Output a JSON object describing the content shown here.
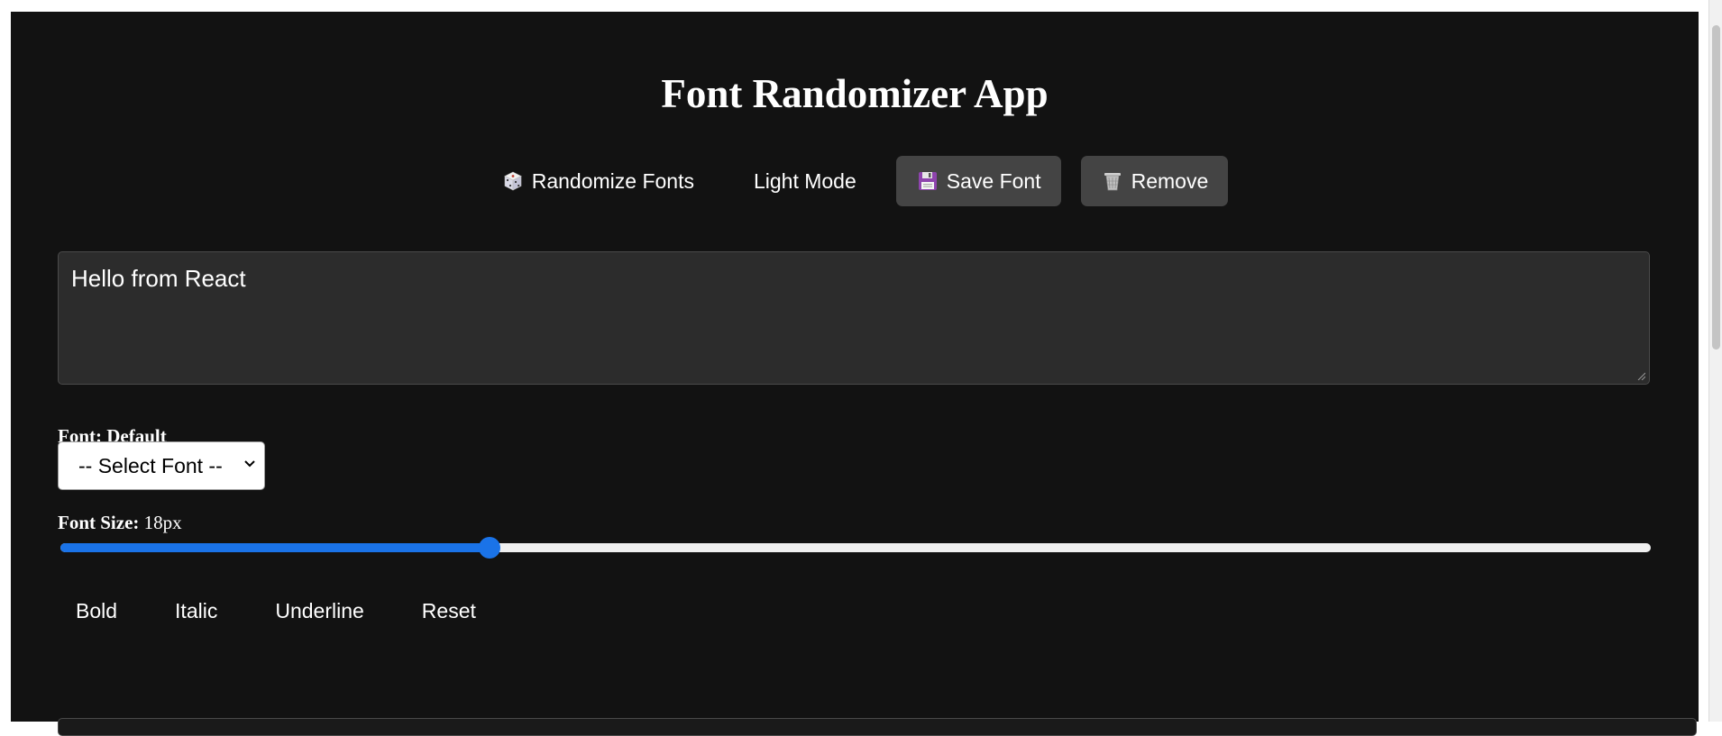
{
  "app": {
    "title": "Font Randomizer App"
  },
  "toolbar": {
    "randomize_label": "Randomize Fonts",
    "randomize_icon": "dice-icon",
    "theme_label": "Light Mode",
    "save_label": "Save Font",
    "save_icon": "floppy-disk-icon",
    "remove_label": "Remove",
    "remove_icon": "wastebasket-icon"
  },
  "editor": {
    "text": "Hello from React"
  },
  "font": {
    "label": "Font:",
    "value": "Default"
  },
  "font_select": {
    "selected": "-- Select Font --"
  },
  "font_size": {
    "label": "Font Size:",
    "value_text": "18px",
    "slider_fraction": 0.27
  },
  "format": {
    "bold_label": "Bold",
    "italic_label": "Italic",
    "underline_label": "Underline",
    "reset_label": "Reset"
  },
  "colors": {
    "background": "#121212",
    "button_filled": "#444444",
    "accent": "#1a73e8",
    "textarea_bg": "#2c2c2c"
  }
}
